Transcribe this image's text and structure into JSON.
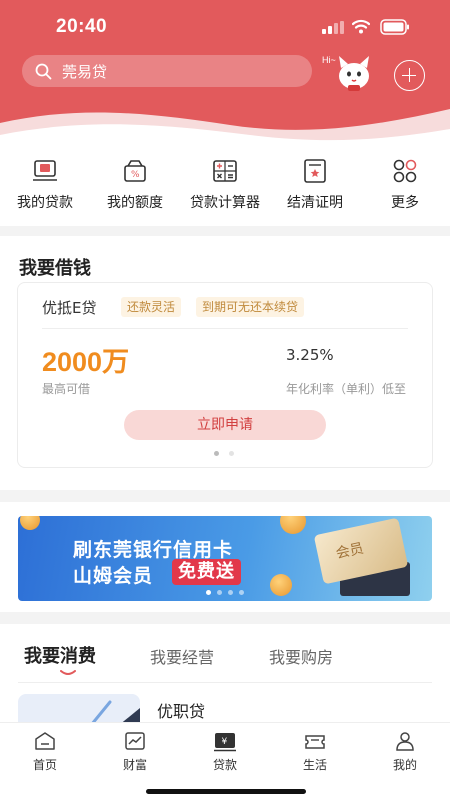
{
  "status_bar": {
    "time": "20:40"
  },
  "search": {
    "placeholder": "莞易贷",
    "icon": "search-icon"
  },
  "header": {
    "hi_text": "Hi~",
    "accent": "#e25a5c"
  },
  "quick_menu": [
    {
      "label": "我的贷款",
      "icon": "loan-icon"
    },
    {
      "label": "我的额度",
      "icon": "quota-icon"
    },
    {
      "label": "贷款计算器",
      "icon": "calculator-icon"
    },
    {
      "label": "结清证明",
      "icon": "certificate-icon"
    },
    {
      "label": "更多",
      "icon": "more-icon"
    }
  ],
  "borrow": {
    "title": "我要借钱",
    "product_name": "优抵E贷",
    "tags": [
      "还款灵活",
      "到期可无还本续贷"
    ],
    "amount": "2000万",
    "amount_label": "最高可借",
    "rate": "3.25%",
    "rate_label": "年化利率（单利）低至",
    "apply_label": "立即申请",
    "carousel_pages": 2,
    "carousel_active": 0
  },
  "banner": {
    "line1": "刷东莞银行信用卡",
    "line2": "山姆会员",
    "highlight": "免费送",
    "card_text": "会员",
    "carousel_pages": 4,
    "carousel_active": 0
  },
  "consume": {
    "tabs": [
      "我要消费",
      "我要经营",
      "我要购房"
    ],
    "active_tab": 0,
    "product_title": "优职贷"
  },
  "bottom_nav": [
    {
      "label": "首页",
      "icon": "home-icon"
    },
    {
      "label": "财富",
      "icon": "wealth-icon"
    },
    {
      "label": "贷款",
      "icon": "loan-nav-icon",
      "active": true
    },
    {
      "label": "生活",
      "icon": "life-icon"
    },
    {
      "label": "我的",
      "icon": "profile-icon"
    }
  ],
  "colors": {
    "primary": "#e25a5c",
    "amount": "#f08c1f",
    "tag_text": "#c08a3c",
    "apply_bg": "#f9d8d6"
  }
}
